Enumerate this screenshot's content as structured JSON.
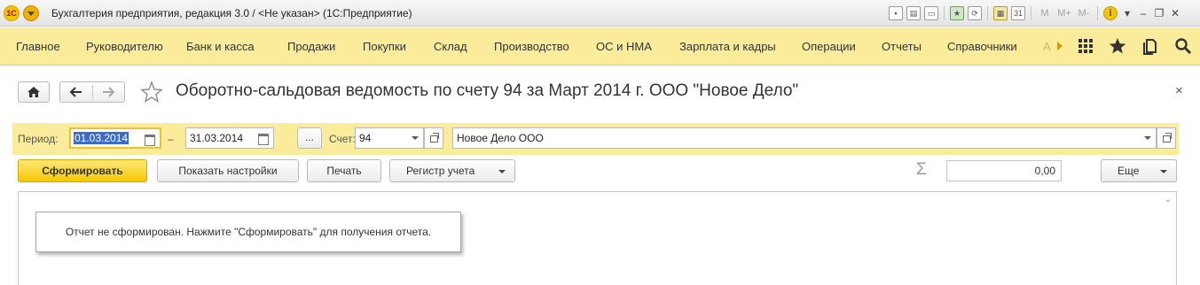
{
  "app": {
    "logo_text": "1С",
    "window_title": "Бухгалтерия предприятия, редакция 3.0 / <Не указан>  (1С:Предприятие)",
    "memory_buttons": [
      "M",
      "M+",
      "M-"
    ],
    "info_icon": "i"
  },
  "menu": {
    "items": [
      "Главное",
      "Руководителю",
      "Банк и касса",
      "Продажи",
      "Покупки",
      "Склад",
      "Производство",
      "ОС и НМА",
      "Зарплата и кадры",
      "Операции",
      "Отчеты",
      "Справочники"
    ],
    "overflow_text": "А",
    "icons": [
      "grid-icon",
      "star-icon",
      "history-icon",
      "search-icon"
    ]
  },
  "form": {
    "title": "Оборотно-сальдовая ведомость по счету 94 за Март 2014 г. ООО \"Новое Дело\"",
    "close": "×"
  },
  "params": {
    "period_label": "Период:",
    "date_from": "01.03.2014",
    "dash": "–",
    "date_to": "31.03.2014",
    "dots": "...",
    "account_label": "Счет:",
    "account": "94",
    "organization": "Новое Дело ООО"
  },
  "commands": {
    "generate": "Сформировать",
    "show_settings": "Показать настройки",
    "print": "Печать",
    "register": "Регистр учета",
    "sigma": "Σ",
    "sum": "0,00",
    "more": "Еще"
  },
  "report": {
    "notice": "Отчет не сформирован. Нажмите \"Сформировать\" для получения отчета."
  },
  "colors": {
    "menu_bg": "#fbec9b",
    "primary_button": "#f5c800",
    "selection": "#3b6bc8"
  }
}
